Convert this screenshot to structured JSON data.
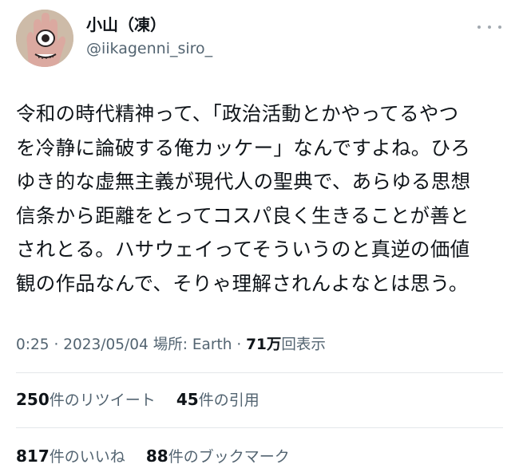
{
  "author": {
    "display_name": "小山（凍）",
    "handle": "@iikagenni_siro_"
  },
  "tweet": {
    "lines": [
      "令和の時代精神って、「政治活動とかやってるやつ",
      "を冷静に論破する俺カッケー」なんですよね。ひろ",
      "ゆき的な虚無主義が現代人の聖典で、あらゆる思想",
      "信条から距離をとってコスパ良く生きることが善と",
      "されとる。ハサウェイってそういうのと真逆の価値",
      "観の作品なんで、そりゃ理解されんよなとは思う。"
    ]
  },
  "meta": {
    "time": "0:25",
    "date": "2023/05/04",
    "location_label": "場所: Earth",
    "views_count": "71万",
    "views_label": "回表示"
  },
  "stats": {
    "retweets_count": "250",
    "retweets_label": "件のリツイート",
    "quotes_count": "45",
    "quotes_label": "件の引用",
    "likes_count": "817",
    "likes_label": "件のいいね",
    "bookmarks_count": "88",
    "bookmarks_label": "件のブックマーク"
  },
  "icons": {
    "more": "more-horizontal-icon",
    "avatar": "avatar-hand-eye-illustration"
  },
  "colors": {
    "text_primary": "#0f1419",
    "text_secondary": "#536471",
    "divider": "#e3e7ea"
  }
}
